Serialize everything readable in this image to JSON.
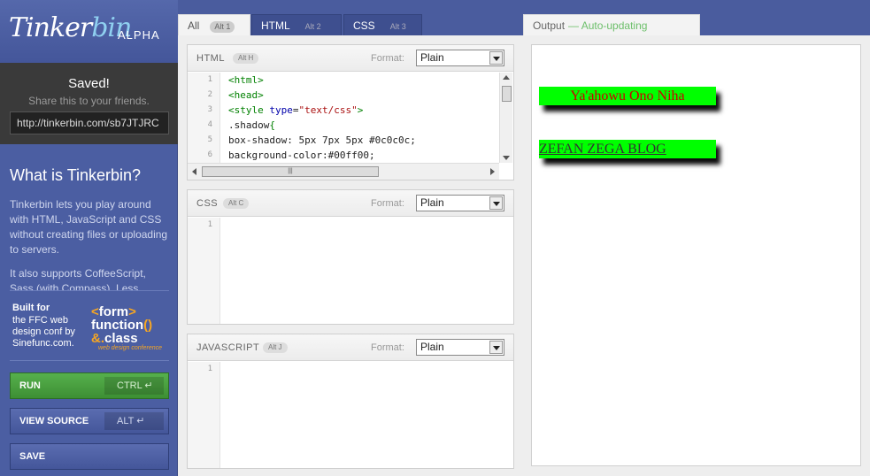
{
  "sidebar": {
    "logo_brand": "Tinker",
    "logo_brand_b": "bin",
    "logo_alpha": "ALPHA",
    "saved_title": "Saved!",
    "saved_sub": "Share this to your friends.",
    "saved_url": "http://tinkerbin.com/sb7JTJRC",
    "what_title": "What is Tinkerbin?",
    "para1": "Tinkerbin lets you play around with HTML, JavaScript and CSS without creating files or uploading to servers.",
    "para2": "It also supports CoffeeScript, Sass (with Compass), Less, HAML, and more.",
    "built_for": "Built for",
    "built_desc": "the FFC web design conf by Sinefunc.com.",
    "ffc_form": "form",
    "ffc_function": "function",
    "ffc_class": "class",
    "ffc_sub": "web design conference",
    "run_label": "RUN",
    "run_key": "CTRL ↵",
    "view_label": "VIEW SOURCE",
    "view_key": "ALT ↵",
    "save_label": "SAVE"
  },
  "tabs": [
    {
      "label": "All",
      "alt": "Alt 1"
    },
    {
      "label": "HTML",
      "alt": "Alt 2"
    },
    {
      "label": "CSS",
      "alt": "Alt 3"
    }
  ],
  "panels": {
    "html": {
      "name": "HTML",
      "alt": "Alt H",
      "format_label": "Format:",
      "format_value": "Plain",
      "line_numbers": [
        "1",
        "2",
        "3",
        "4",
        "5",
        "6"
      ]
    },
    "css": {
      "name": "CSS",
      "alt": "Alt C",
      "format_label": "Format:",
      "format_value": "Plain",
      "line_numbers": [
        "1"
      ]
    },
    "js": {
      "name": "JAVASCRIPT",
      "alt": "Alt J",
      "format_label": "Format:",
      "format_value": "Plain",
      "line_numbers": [
        "1"
      ]
    }
  },
  "html_code": {
    "l1": "<html>",
    "l2": "<head>",
    "l3_tag_open": "<style ",
    "l3_attr": "type",
    "l3_eq": "=",
    "l3_str": "\"text/css\"",
    "l3_close": ">",
    "l4_text": ".shadow",
    "l4_brace": "{",
    "l5": "box-shadow: 5px 7px 5px #0c0c0c;",
    "l6": "background-color:#00ff00;"
  },
  "output": {
    "tab_label": "Output",
    "auto_label": "— Auto-updating",
    "item1": "Ya'ahowu Ono Niha",
    "item2": "ZEFAN ZEGA BLOG"
  },
  "colors": {
    "sidebar_bg": "#4b5ea2",
    "run_green": "#3d8f34",
    "output_box_bg": "#00ff00",
    "output_shadow": "#0c0c0c"
  }
}
